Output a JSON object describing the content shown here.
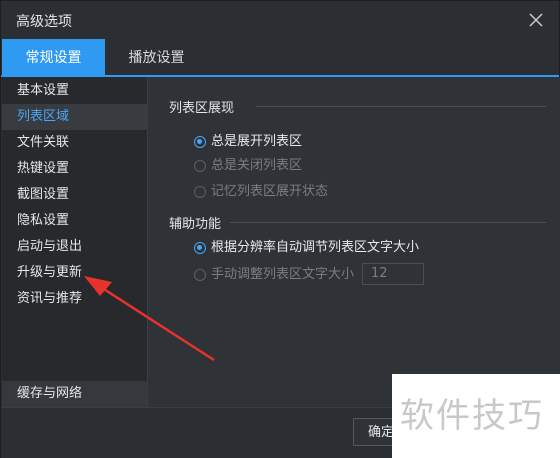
{
  "window": {
    "title": "高级选项"
  },
  "tabs": [
    {
      "label": "常规设置",
      "active": true
    },
    {
      "label": "播放设置",
      "active": false
    }
  ],
  "sidebar": {
    "items": [
      {
        "label": "基本设置",
        "selected": false
      },
      {
        "label": "列表区域",
        "selected": true
      },
      {
        "label": "文件关联",
        "selected": false
      },
      {
        "label": "热键设置",
        "selected": false
      },
      {
        "label": "截图设置",
        "selected": false
      },
      {
        "label": "隐私设置",
        "selected": false
      },
      {
        "label": "启动与退出",
        "selected": false
      },
      {
        "label": "升级与更新",
        "selected": false
      },
      {
        "label": "资讯与推荐",
        "selected": false
      }
    ],
    "bottom_item": "缓存与网络"
  },
  "main": {
    "section1": {
      "title": "列表区展现",
      "options": [
        {
          "label": "总是展开列表区",
          "checked": true
        },
        {
          "label": "总是关闭列表区",
          "checked": false
        },
        {
          "label": "记忆列表区展开状态",
          "checked": false
        }
      ]
    },
    "section2": {
      "title": "辅助功能",
      "options": [
        {
          "label": "根据分辨率自动调节列表区文字大小",
          "checked": true
        },
        {
          "label": "手动调整列表区文字大小",
          "checked": false
        }
      ],
      "font_size_value": "12"
    }
  },
  "footer": {
    "ok_label": "确定"
  },
  "watermark": "软件技巧",
  "colors": {
    "accent": "#2f9af2",
    "selected_text": "#4aa6f5",
    "arrow": "#e8322b"
  }
}
